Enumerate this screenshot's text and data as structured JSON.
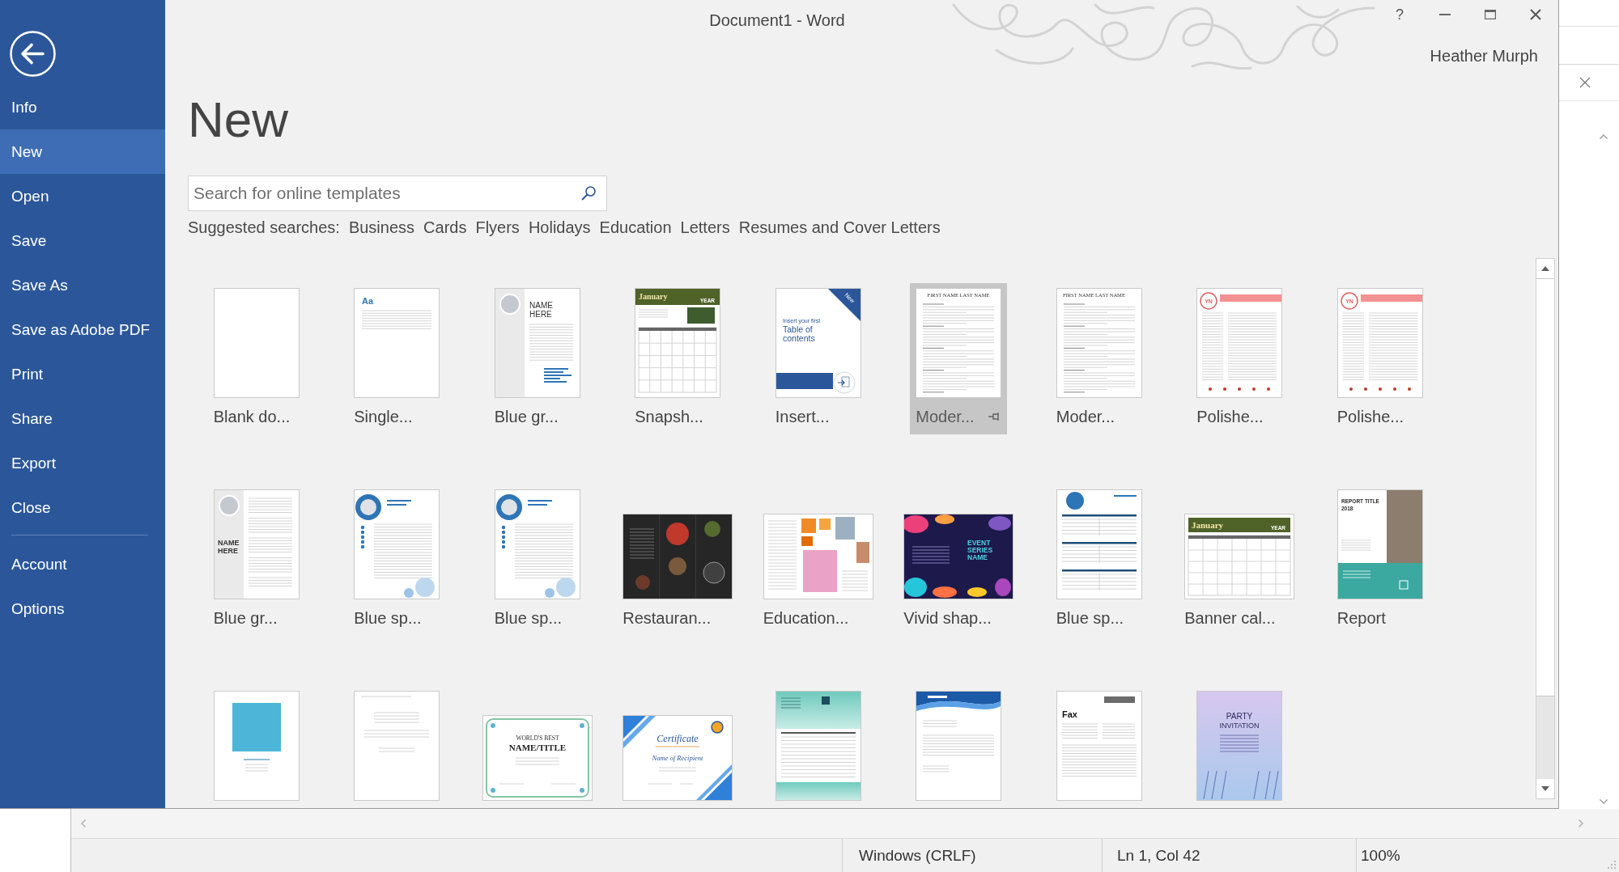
{
  "window": {
    "title": "Document1 - Word",
    "help": "?",
    "user": "Heather Murph"
  },
  "sidebar": {
    "items": [
      {
        "label": "Info",
        "selected": false
      },
      {
        "label": "New",
        "selected": true
      },
      {
        "label": "Open",
        "selected": false
      },
      {
        "label": "Save",
        "selected": false
      },
      {
        "label": "Save As",
        "selected": false
      },
      {
        "label": "Save as Adobe PDF",
        "selected": false
      },
      {
        "label": "Print",
        "selected": false
      },
      {
        "label": "Share",
        "selected": false
      },
      {
        "label": "Export",
        "selected": false
      },
      {
        "label": "Close",
        "selected": false
      }
    ],
    "bottom_items": [
      {
        "label": "Account",
        "selected": false
      },
      {
        "label": "Options",
        "selected": false
      }
    ]
  },
  "page": {
    "heading": "New",
    "search": {
      "placeholder": "Search for online templates"
    },
    "suggested_searches": {
      "label": "Suggested searches:",
      "links": [
        "Business",
        "Cards",
        "Flyers",
        "Holidays",
        "Education",
        "Letters",
        "Resumes and Cover Letters"
      ]
    }
  },
  "templates": [
    {
      "label": "Blank do...",
      "selected": false,
      "preview": {
        "kind": "blank"
      }
    },
    {
      "label": "Single...",
      "selected": false,
      "preview": {
        "kind": "single",
        "lines": [
          "Aa"
        ]
      }
    },
    {
      "label": "Blue gr...",
      "selected": false,
      "preview": {
        "kind": "photo_resume",
        "lines": [
          "NAME",
          "HERE"
        ]
      }
    },
    {
      "label": "Snapsh...",
      "selected": false,
      "preview": {
        "kind": "photo_calendar",
        "lines": [
          "January",
          "YEAR"
        ]
      }
    },
    {
      "label": "Insert...",
      "selected": false,
      "preview": {
        "kind": "toc",
        "badge": "New",
        "lines": [
          "Insert your first",
          "Table of",
          "contents"
        ]
      }
    },
    {
      "label": "Moder...",
      "selected": true,
      "preview": {
        "kind": "resume_centered",
        "lines": [
          "FIRST NAME LAST NAME"
        ]
      }
    },
    {
      "label": "Moder...",
      "selected": false,
      "preview": {
        "kind": "resume_left",
        "lines": [
          "FIRST NAME LAST NAME"
        ]
      }
    },
    {
      "label": "Polishe...",
      "selected": false,
      "preview": {
        "kind": "polished",
        "lines": [
          "YN"
        ]
      }
    },
    {
      "label": "Polishe...",
      "selected": false,
      "preview": {
        "kind": "polished",
        "lines": [
          "YN"
        ]
      }
    },
    {
      "label": "Blue gr...",
      "selected": false,
      "preview": {
        "kind": "cover_letter",
        "lines": [
          "NAME",
          "HERE"
        ]
      }
    },
    {
      "label": "Blue sp...",
      "selected": false,
      "preview": {
        "kind": "spheres_resume"
      }
    },
    {
      "label": "Blue sp...",
      "selected": false,
      "preview": {
        "kind": "spheres_resume"
      }
    },
    {
      "label": "Restauran...",
      "selected": false,
      "preview": {
        "kind": "restaurant"
      }
    },
    {
      "label": "Education...",
      "selected": false,
      "preview": {
        "kind": "collage"
      }
    },
    {
      "label": "Vivid shap...",
      "selected": false,
      "preview": {
        "kind": "vivid",
        "lines": [
          "EVENT",
          "SERIES",
          "NAME"
        ]
      }
    },
    {
      "label": "Blue sp...",
      "selected": false,
      "preview": {
        "kind": "spheres_calendar"
      }
    },
    {
      "label": "Banner cal...",
      "selected": false,
      "preview": {
        "kind": "banner_calendar",
        "lines": [
          "January",
          "YEAR"
        ]
      }
    },
    {
      "label": "Report",
      "selected": false,
      "preview": {
        "kind": "report",
        "lines": [
          "REPORT TITLE",
          "2018"
        ]
      }
    },
    {
      "selected": false,
      "preview": {
        "kind": "photo_report"
      }
    },
    {
      "selected": false,
      "preview": {
        "kind": "letter"
      }
    },
    {
      "selected": false,
      "preview": {
        "kind": "floral_certificate",
        "lines": [
          "WORLD'S BEST",
          "NAME/TITLE"
        ]
      }
    },
    {
      "selected": false,
      "preview": {
        "kind": "blue_certificate",
        "lines": [
          "Certificate",
          "Name of Recipient"
        ]
      }
    },
    {
      "selected": false,
      "preview": {
        "kind": "invoice"
      }
    },
    {
      "selected": false,
      "preview": {
        "kind": "wave_letter"
      }
    },
    {
      "selected": false,
      "preview": {
        "kind": "fax",
        "lines": [
          "Fax"
        ]
      }
    },
    {
      "selected": false,
      "preview": {
        "kind": "party",
        "lines": [
          "PARTY",
          "INVITATION"
        ]
      }
    }
  ],
  "background_window": {
    "status_bar": [
      "Windows (CRLF)",
      "Ln 1, Col 42",
      "100%"
    ]
  }
}
